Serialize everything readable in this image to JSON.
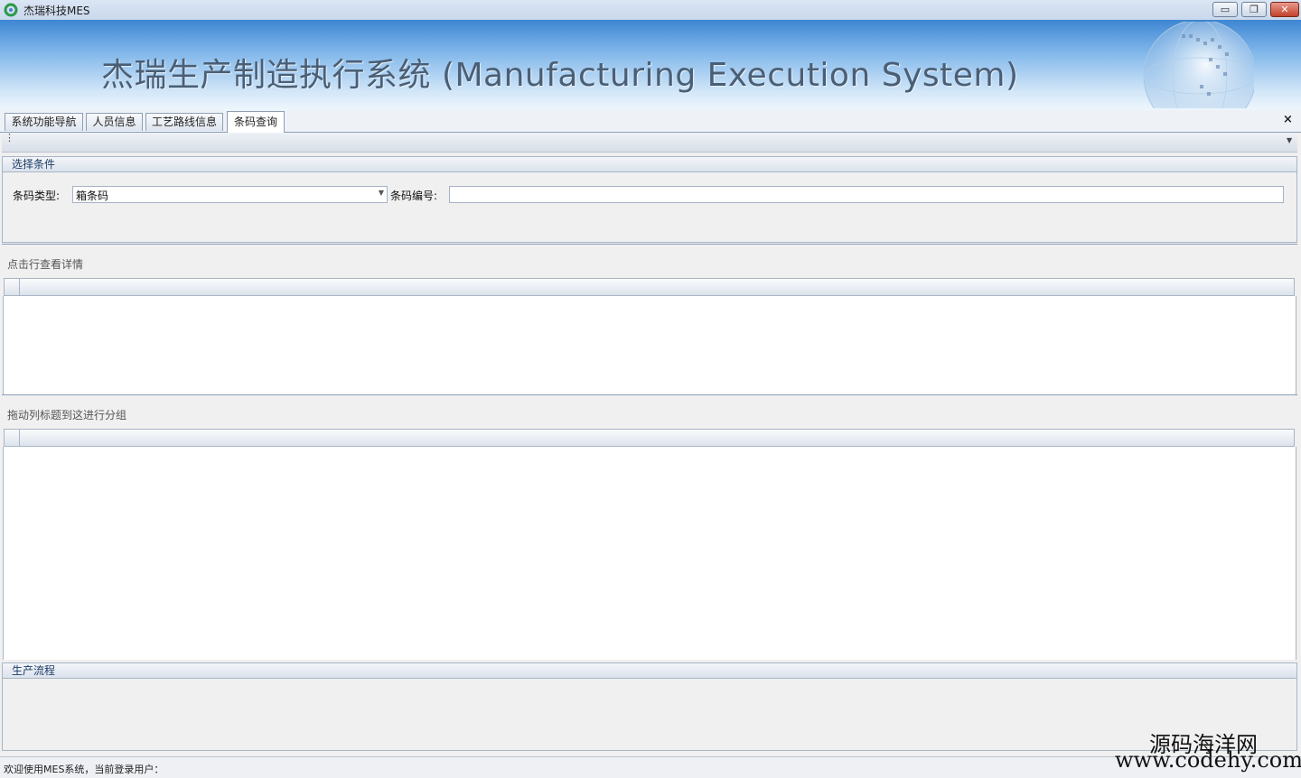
{
  "window": {
    "title": "杰瑞科技MES",
    "controls": {
      "minimize": "▭",
      "restore": "❐",
      "close": "✕"
    }
  },
  "banner": {
    "title": "杰瑞生产制造执行系统 (Manufacturing Execution System)"
  },
  "tabs": [
    {
      "label": "系统功能导航",
      "active": false
    },
    {
      "label": "人员信息",
      "active": false
    },
    {
      "label": "工艺路线信息",
      "active": false
    },
    {
      "label": "条码查询",
      "active": true
    }
  ],
  "tab_close": "×",
  "condition_group": {
    "title": "选择条件",
    "barcode_type_label": "条码类型:",
    "barcode_type_value": "箱条码",
    "barcode_number_label": "条码编号:",
    "barcode_number_value": ""
  },
  "grid1": {
    "caption": "点击行查看详情"
  },
  "grid2": {
    "caption": "拖动列标题到这进行分组"
  },
  "process_group": {
    "title": "生产流程"
  },
  "status": {
    "text": "欢迎使用MES系统，当前登录用户："
  },
  "watermark": {
    "line1": "源码海洋网",
    "line2": "www.codehy.com"
  },
  "colors": {
    "banner_top": "#3e86d2",
    "banner_bottom": "#eef6fd",
    "group_title": "#1d3d66"
  }
}
